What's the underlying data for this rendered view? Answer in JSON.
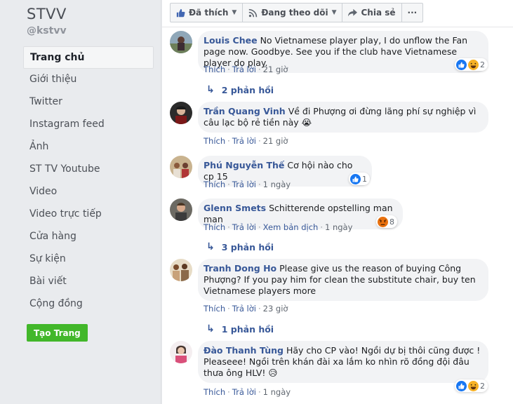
{
  "sidebar": {
    "page_name": "STVV",
    "handle": "@kstvv",
    "items": [
      {
        "label": "Trang chủ"
      },
      {
        "label": "Giới thiệu"
      },
      {
        "label": "Twitter"
      },
      {
        "label": "Instagram feed"
      },
      {
        "label": "Ảnh"
      },
      {
        "label": "ST TV Youtube"
      },
      {
        "label": "Video"
      },
      {
        "label": "Video trực tiếp"
      },
      {
        "label": "Cửa hàng"
      },
      {
        "label": "Sự kiện"
      },
      {
        "label": "Bài viết"
      },
      {
        "label": "Cộng đồng"
      }
    ],
    "create_page": "Tạo Trang"
  },
  "toolbar": {
    "liked": "Đã thích",
    "following": "Đang theo dõi",
    "share": "Chia sẻ",
    "more": "···"
  },
  "comments": [
    {
      "author": "Louis Chee",
      "text": "No Vietnamese player play, I do unflow the Fan page now. Goodbye. See you if the club have Vietnamese player do play.",
      "like": "Thích",
      "reply": "Trả lời",
      "time": "21 giờ",
      "reaction_count": "2",
      "replies": "2 phản hồi"
    },
    {
      "author": "Trần Quang Vinh",
      "text": "Về đi Phượng ơi đừng lãng phí sự nghiệp vì câu lạc bộ rẻ tiền này 😭",
      "like": "Thích",
      "reply": "Trả lời",
      "time": "21 giờ"
    },
    {
      "author": "Phú Nguyễn Thế",
      "text": "Cơ hội nào cho cp 15",
      "like": "Thích",
      "reply": "Trả lời",
      "time": "1 ngày",
      "reaction_count": "1"
    },
    {
      "author": "Glenn Smets",
      "text": "Schitterende opstelling man man",
      "like": "Thích",
      "reply": "Trả lời",
      "translate": "Xem bản dịch",
      "time": "1 ngày",
      "reaction_count": "8",
      "replies": "3 phản hồi"
    },
    {
      "author": "Tranh Dong Ho",
      "text": "Please give us the reason of buying Công Phượng? If you pay him for clean the substitute chair, buy ten Vietnamese players more",
      "like": "Thích",
      "reply": "Trả lời",
      "time": "23 giờ",
      "replies": "1 phản hồi"
    },
    {
      "author": "Đào Thanh Tùng",
      "text": "Hãy cho CP vào! Ngồi dự bị thôi cũng được ! Pleaseee! Ngồi trên khán đài xa lắm ko nhìn rõ đồng đội đâu thưa ông HLV! 😥",
      "like": "Thích",
      "reply": "Trả lời",
      "time": "1 ngày",
      "reaction_count": "2"
    }
  ],
  "colors": {
    "link": "#385898",
    "create_button": "#42b72a",
    "like_reaction": "#1877f2",
    "haha_reaction": "#f7b125",
    "angry_reaction": "#e9710f"
  }
}
